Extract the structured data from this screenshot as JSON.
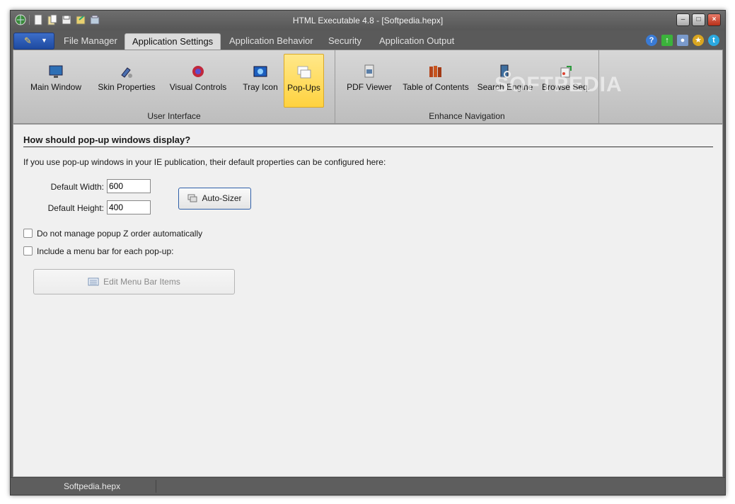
{
  "window": {
    "title": "HTML Executable 4.8 - [Softpedia.hepx]"
  },
  "quick_access": [
    "app-globe-icon",
    "new-document-icon",
    "open-document-icon",
    "save-icon",
    "export-icon",
    "build-icon"
  ],
  "tabs": [
    {
      "label": "File Manager",
      "active": false
    },
    {
      "label": "Application Settings",
      "active": true
    },
    {
      "label": "Application Behavior",
      "active": false
    },
    {
      "label": "Security",
      "active": false
    },
    {
      "label": "Application Output",
      "active": false
    }
  ],
  "top_icons": [
    "help-icon",
    "update-icon",
    "user-icon",
    "award-icon",
    "twitter-icon"
  ],
  "ribbon": {
    "groups": [
      {
        "label": "User Interface",
        "buttons": [
          {
            "label": "Main Window",
            "icon": "monitor-icon"
          },
          {
            "label": "Skin Properties",
            "icon": "paint-icon"
          },
          {
            "label": "Visual Controls",
            "icon": "controls-icon"
          },
          {
            "label": "Tray Icon",
            "icon": "tray-icon"
          },
          {
            "label": "Pop-Ups",
            "icon": "popups-icon",
            "selected": true
          }
        ]
      },
      {
        "label": "Enhance Navigation",
        "buttons": [
          {
            "label": "PDF Viewer",
            "icon": "pdf-icon"
          },
          {
            "label": "Table of Contents",
            "icon": "books-icon"
          },
          {
            "label": "Search Engine",
            "icon": "search-engine-icon"
          },
          {
            "label": "Browse Seq.",
            "icon": "browse-seq-icon"
          }
        ]
      }
    ],
    "watermark": "SOFTPEDIA"
  },
  "content": {
    "heading": "How should pop-up windows display?",
    "description": "If you use pop-up windows in your IE publication, their default properties can be configured here:",
    "width_label": "Default Width:",
    "width_value": "600",
    "height_label": "Default Height:",
    "height_value": "400",
    "autosizer_label": "Auto-Sizer",
    "check_zorder": "Do not manage popup Z order automatically",
    "check_menubar": "Include a menu bar for each pop-up:",
    "edit_menu_label": "Edit Menu Bar Items"
  },
  "status": {
    "file": "Softpedia.hepx"
  },
  "colors": {
    "ribbon_selected": "#ffd23f",
    "app_button": "#1e4aa0",
    "chrome": "#5a5a5a"
  }
}
